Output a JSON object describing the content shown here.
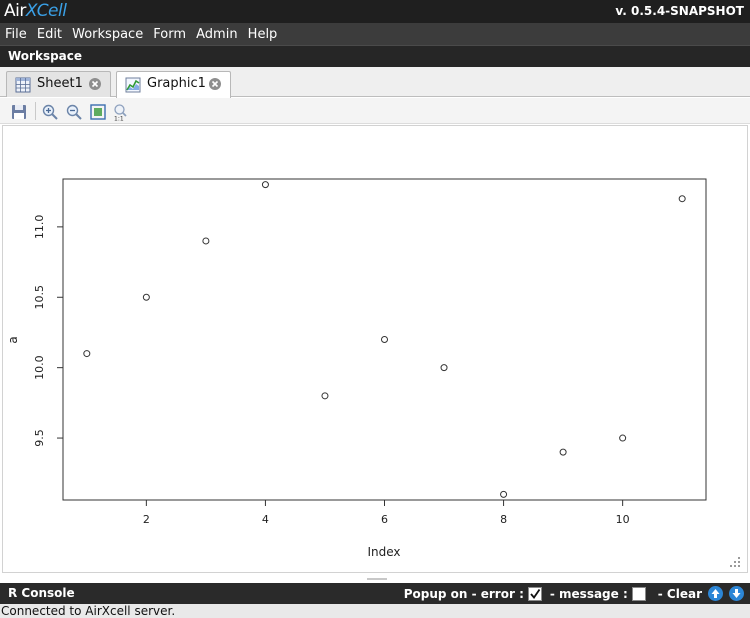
{
  "app": {
    "logo_part1": "Air",
    "logo_part2": "XCell",
    "version": "v. 0.5.4-SNAPSHOT"
  },
  "menu": [
    "File",
    "Edit",
    "Workspace",
    "Form",
    "Admin",
    "Help"
  ],
  "workspace": {
    "title": "Workspace"
  },
  "tabs": [
    {
      "label": "Sheet1",
      "icon": "grid-icon",
      "active": false
    },
    {
      "label": "Graphic1",
      "icon": "chart-icon",
      "active": true
    }
  ],
  "toolbar": {
    "icons": [
      "save-icon",
      "zoom-in-icon",
      "zoom-out-icon",
      "zoom-fit-icon",
      "zoom-actual-icon"
    ]
  },
  "chart_data": {
    "type": "scatter",
    "x": [
      1,
      2,
      3,
      4,
      5,
      6,
      7,
      8,
      9,
      10,
      11
    ],
    "y": [
      10.1,
      10.5,
      10.9,
      11.3,
      9.8,
      10.2,
      10.0,
      9.1,
      9.4,
      9.5,
      11.2
    ],
    "xlabel": "Index",
    "ylabel": "a",
    "xticks": [
      "2",
      "4",
      "6",
      "8",
      "10"
    ],
    "yticks": [
      "9.5",
      "10.0",
      "10.5",
      "11.0"
    ],
    "xlim": [
      0.6,
      11.4
    ],
    "ylim": [
      9.06,
      11.34
    ],
    "grid": false,
    "marker": "open-circle"
  },
  "console": {
    "title": "R Console",
    "popup_label": "Popup on - error :",
    "message_label": "- message :",
    "clear_label": "- Clear",
    "error_checked": true,
    "message_checked": false
  },
  "status": {
    "text": "Connected to AirXcell server."
  }
}
